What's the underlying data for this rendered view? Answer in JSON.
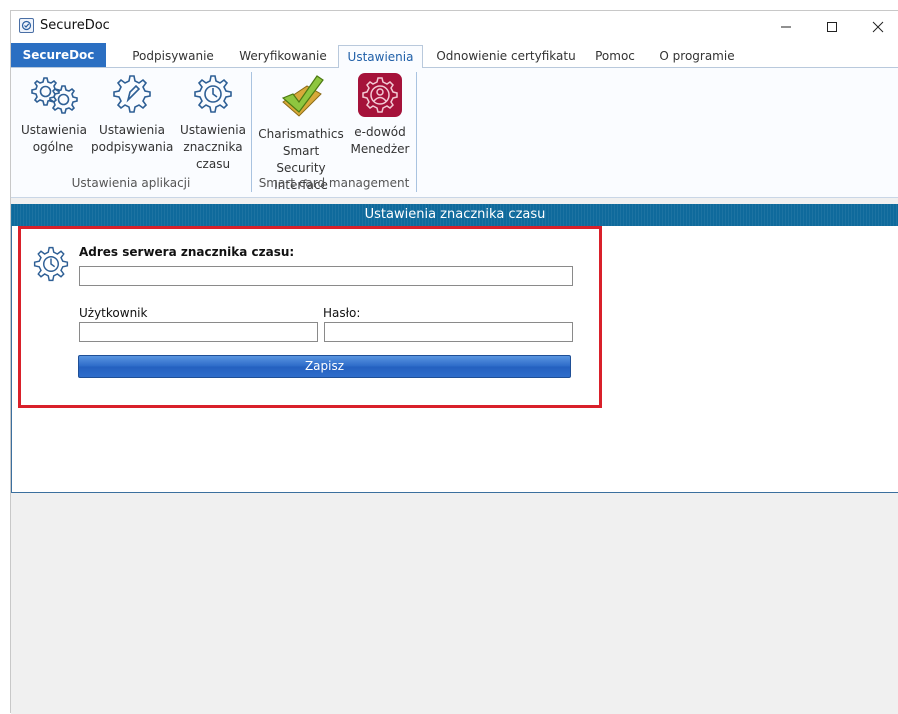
{
  "window": {
    "title": "SecureDoc"
  },
  "tabs": [
    {
      "label": "SecureDoc"
    },
    {
      "label": "Podpisywanie"
    },
    {
      "label": "Weryfikowanie"
    },
    {
      "label": "Ustawienia",
      "active": true
    },
    {
      "label": "Odnowienie certyfikatu"
    },
    {
      "label": "Pomoc"
    },
    {
      "label": "O programie"
    }
  ],
  "ribbon": {
    "app_settings": {
      "group_label": "Ustawienia aplikacji",
      "buttons": [
        {
          "line1": "Ustawienia",
          "line2": "ogólne",
          "icon": "gear-icon"
        },
        {
          "line1": "Ustawienia",
          "line2": "podpisywania",
          "icon": "gear-pen-icon"
        },
        {
          "line1": "Ustawienia",
          "line2": "znacznika",
          "line3": "czasu",
          "icon": "gear-clock-icon"
        }
      ]
    },
    "smart_card": {
      "group_label": "Smart card management",
      "buttons": [
        {
          "line1": "Charismathics",
          "line2": "Smart Security",
          "line3": "Interface",
          "icon": "checkmark-card-icon"
        },
        {
          "line1": "e-dowód",
          "line2": "Menedżer",
          "icon": "e-dowod-icon"
        }
      ]
    }
  },
  "section": {
    "title": "Ustawienia znacznika czasu"
  },
  "form": {
    "server_label": "Adres serwera znacznika czasu:",
    "server_value": "",
    "user_label": "Użytkownik",
    "user_value": "",
    "password_label": "Hasło:",
    "password_value": "",
    "save_label": "Zapisz"
  },
  "colors": {
    "accent": "#2b6fc2",
    "header": "#0f6a9c",
    "highlight": "#d9202a"
  }
}
